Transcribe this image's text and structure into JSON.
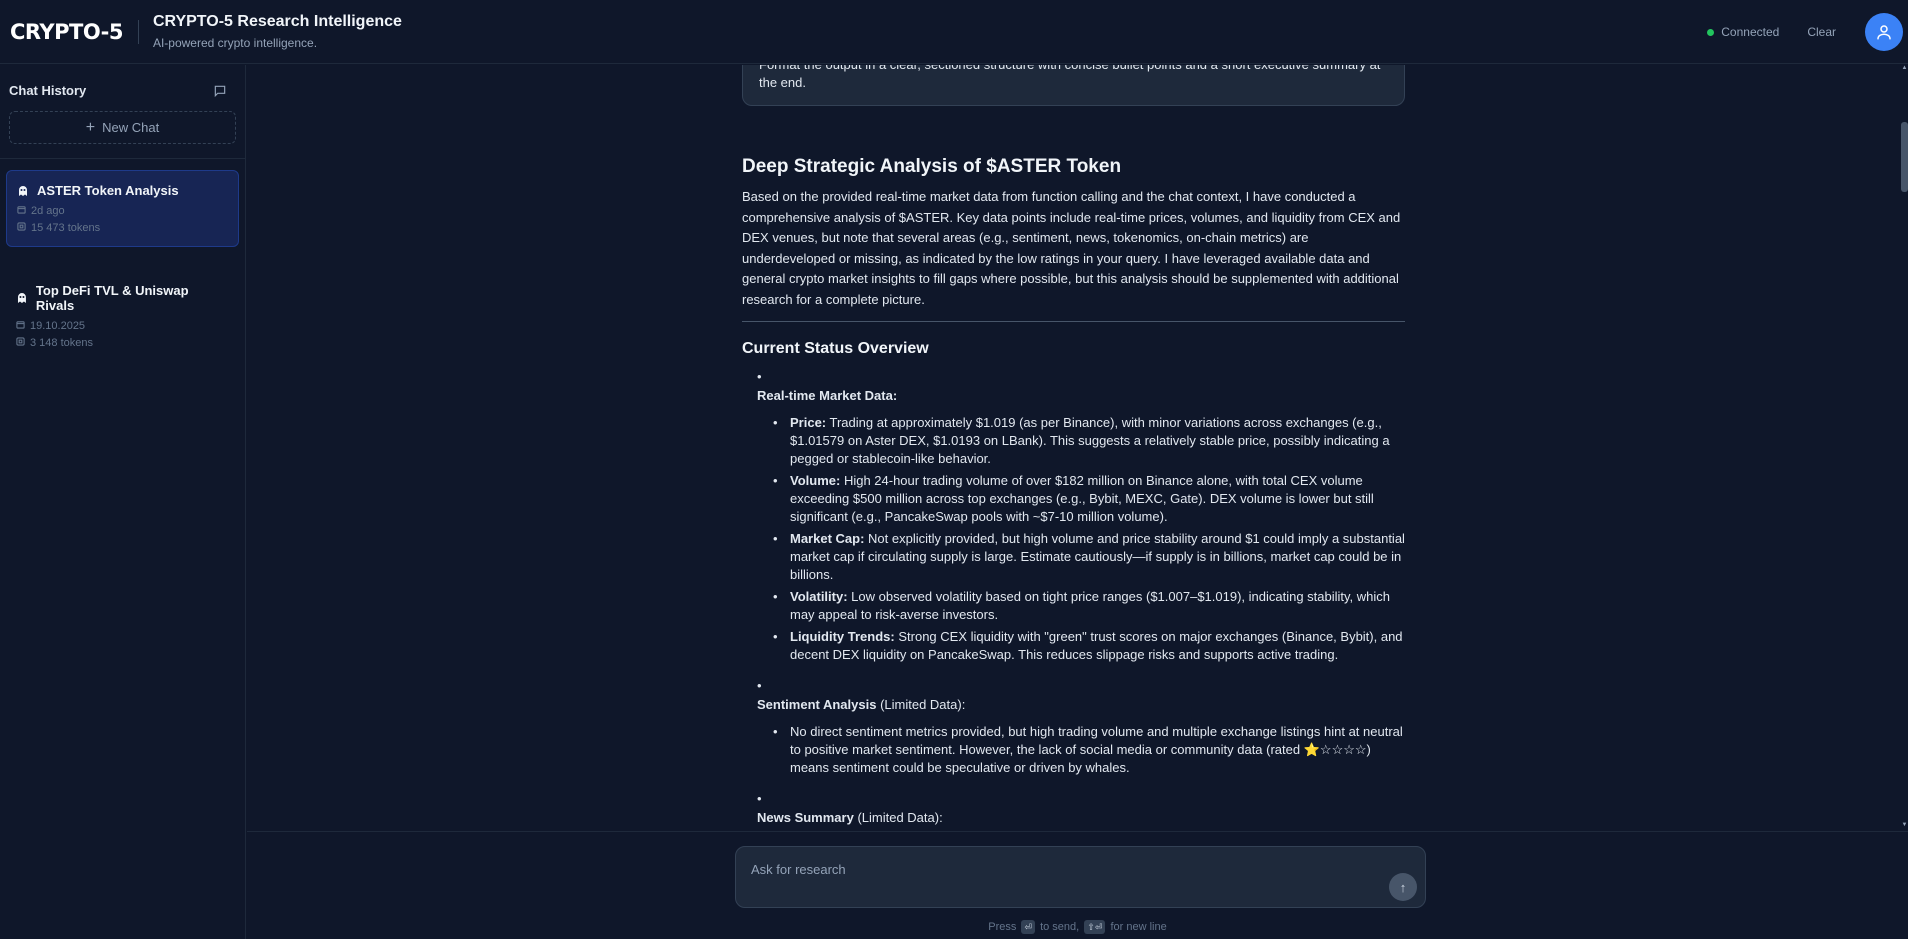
{
  "header": {
    "brand": "CRYPTO-5",
    "title": "CRYPTO-5 Research Intelligence",
    "subtitle": "AI-powered crypto intelligence.",
    "status": "Connected",
    "clear_label": "Clear",
    "status_color": "#22c55e",
    "avatar_color": "#3b82f6"
  },
  "sidebar": {
    "title": "Chat History",
    "new_chat_label": "New Chat",
    "chats": [
      {
        "name": "ASTER Token Analysis",
        "date": "2d ago",
        "tokens": "15 473 tokens",
        "active": true
      },
      {
        "name": "Top DeFi TVL & Uniswap Rivals",
        "date": "19.10.2025",
        "tokens": "3 148 tokens",
        "active": false
      }
    ]
  },
  "conversation": {
    "prompt_tail": "Format the output in a clear, sectioned structure with concise bullet points and a short executive summary at the end.",
    "report_title": "Deep Strategic Analysis of $ASTER Token",
    "intro": "Based on the provided real-time market data from function calling and the chat context, I have conducted a comprehensive analysis of $ASTER. Key data points include real-time prices, volumes, and liquidity from CEX and DEX venues, but note that several areas (e.g., sentiment, news, tokenomics, on-chain metrics) are underdeveloped or missing, as indicated by the low ratings in your query. I have leveraged available data and general crypto market insights to fill gaps where possible, but this analysis should be supplemented with additional research for a complete picture.",
    "section_heading": "Current Status Overview",
    "sections": [
      {
        "title": "Real-time Market Data:",
        "suffix": "",
        "items": [
          {
            "label": "Price:",
            "text": " Trading at approximately $1.019 (as per Binance), with minor variations across exchanges (e.g., $1.01579 on Aster DEX, $1.0193 on LBank). This suggests a relatively stable price, possibly indicating a pegged or stablecoin-like behavior."
          },
          {
            "label": "Volume:",
            "text": " High 24-hour trading volume of over $182 million on Binance alone, with total CEX volume exceeding $500 million across top exchanges (e.g., Bybit, MEXC, Gate). DEX volume is lower but still significant (e.g., PancakeSwap pools with ~$7-10 million volume)."
          },
          {
            "label": "Market Cap:",
            "text": " Not explicitly provided, but high volume and price stability around $1 could imply a substantial market cap if circulating supply is large. Estimate cautiously—if supply is in billions, market cap could be in billions."
          },
          {
            "label": "Volatility:",
            "text": " Low observed volatility based on tight price ranges ($1.007–$1.019), indicating stability, which may appeal to risk-averse investors."
          },
          {
            "label": "Liquidity Trends:",
            "text": " Strong CEX liquidity with \"green\" trust scores on major exchanges (Binance, Bybit), and decent DEX liquidity on PancakeSwap. This reduces slippage risks and supports active trading."
          }
        ]
      },
      {
        "title": "Sentiment Analysis",
        "suffix": " (Limited Data):",
        "items": [
          {
            "label": "",
            "text": "No direct sentiment metrics provided, but high trading volume and multiple exchange listings hint at neutral to positive market sentiment. However, the lack of social media or community data (rated ⭐☆☆☆☆) means sentiment could be speculative or driven by whales."
          }
        ]
      },
      {
        "title": "News Summary",
        "suffix": " (Limited Data):",
        "items": []
      }
    ]
  },
  "composer": {
    "placeholder": "Ask for research",
    "hint_press": "Press",
    "hint_send_key": "⏎",
    "hint_to_send": "to send,",
    "hint_newline_key": "⇧⏎",
    "hint_for_new_line": "for new line"
  }
}
